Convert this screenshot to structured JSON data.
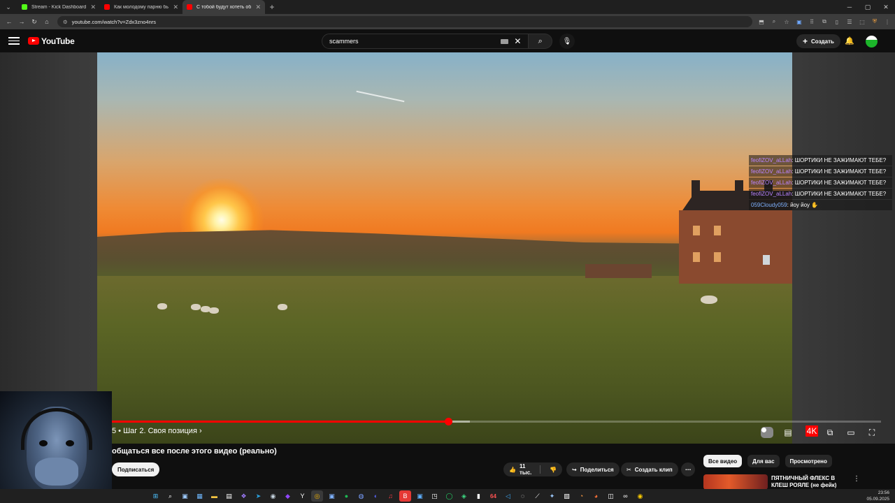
{
  "browser": {
    "tabs": [
      {
        "title": "Stream - Kick Dashboard",
        "favicon_color": "#53fc18",
        "active": false
      },
      {
        "title": "Как молодому парню быстро",
        "favicon_color": "#ff0000",
        "active": false
      },
      {
        "title": "С тобой будут хотеть общатьс",
        "favicon_color": "#ff0000",
        "active": true
      }
    ],
    "new_tab": "+",
    "url": "youtube.com/watch?v=Zdx3zno4nrs"
  },
  "youtube": {
    "logo_text": "YouTube",
    "search_value": "scammers",
    "create_label": "Создать"
  },
  "chat": [
    {
      "user": "feofiZOV_aLLah",
      "text": "ШОРТИКИ НЕ ЗАЖИМАЮТ ТЕБЕ?",
      "color": "#b883ff"
    },
    {
      "user": "feofiZOV_aLLah",
      "text": "ШОРТИКИ НЕ ЗАЖИМАЮТ ТЕБЕ?",
      "color": "#b883ff"
    },
    {
      "user": "feofiZOV_aLLah",
      "text": "ШОРТИКИ НЕ ЗАЖИМАЮТ ТЕБЕ?",
      "color": "#b883ff"
    },
    {
      "user": "feofiZOV_aLLah",
      "text": "ШОРТИКИ НЕ ЗАЖИМАЮТ ТЕБЕ?",
      "color": "#b883ff"
    },
    {
      "user": "059Cloudy059",
      "text": "йоу йоу",
      "color": "#7fb2ff"
    }
  ],
  "player": {
    "chapter_label": "5 • Шаг 2. Своя позиция",
    "progress_played": 0.437,
    "progress_loaded": 0.465,
    "progress_color": "#ff0000"
  },
  "video": {
    "title": "общаться все после этого видео (реально)",
    "subscribe_label": "Подписаться",
    "likes": "11 тыс.",
    "share_label": "Поделиться",
    "clip_label": "Создать клип"
  },
  "sidebar": {
    "chips": [
      {
        "label": "Все видео",
        "active": true
      },
      {
        "label": "Для вас",
        "active": false
      },
      {
        "label": "Просмотрено",
        "active": false
      }
    ],
    "rec_title": "ПЯТНИЧНЫЙ ФЛЕКС В КЛЕШ РОЯЛЕ (не фейк) (Ладно я..."
  },
  "taskbar": {
    "time": "23:56",
    "date": "05.09.2025",
    "badge": "64"
  }
}
